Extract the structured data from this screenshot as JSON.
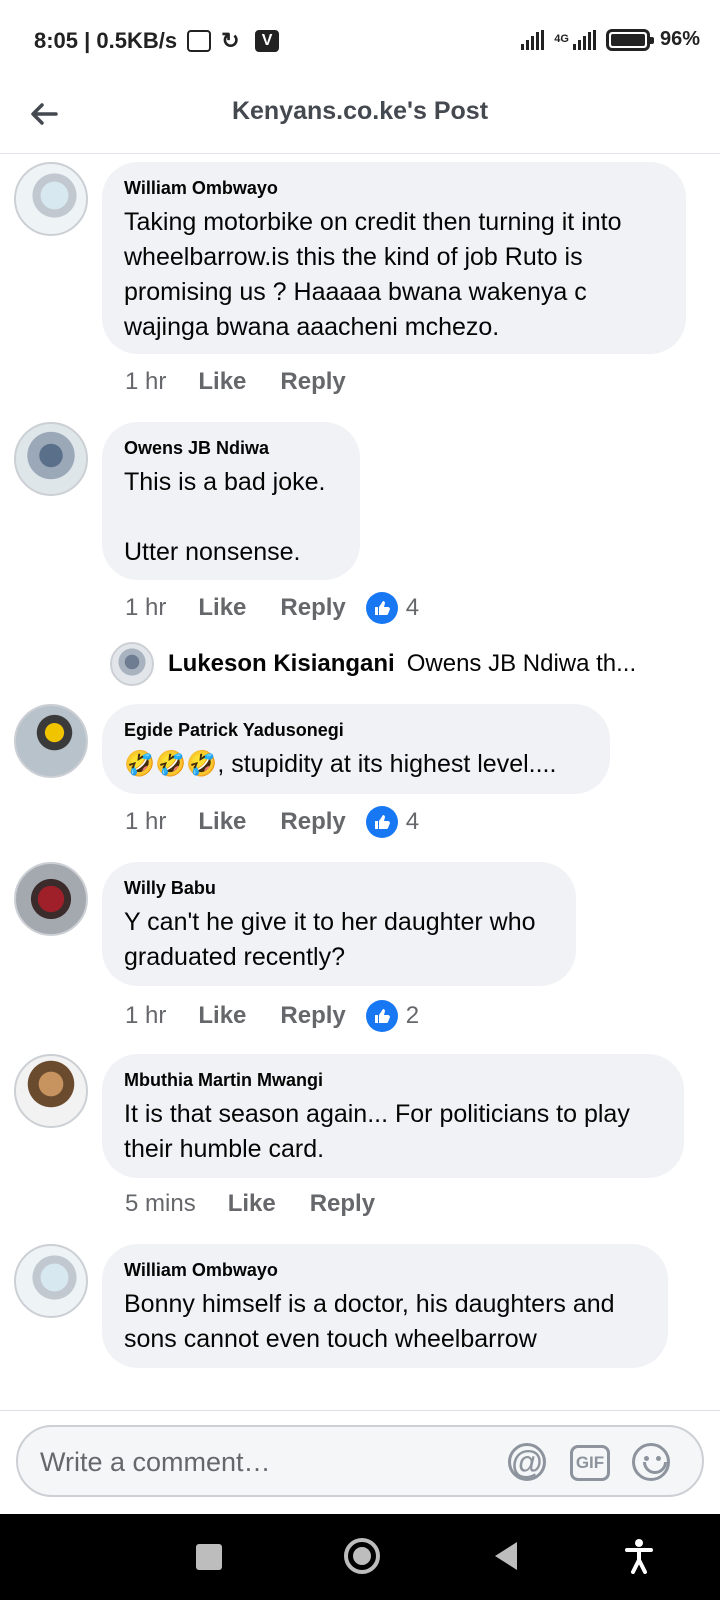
{
  "status_bar": {
    "time_speed": "8:05 | 0.5KB/s",
    "network": "4G",
    "battery": "96%",
    "icons": [
      "photo-icon",
      "swirl-icon",
      "v-app-icon",
      "signal-icon",
      "battery-icon"
    ]
  },
  "header": {
    "title": "Kenyans.co.ke's Post",
    "back_icon": "arrow-left-icon"
  },
  "comments": [
    {
      "author": "William Ombwayo",
      "text": " Taking motorbike on credit then turning it into\n wheelbarrow.is this the kind of job Ruto is\npromising us ? Haaaaa bwana wakenya c\nwajinga bwana aaacheni mchezo.",
      "time": "1 hr",
      "like": "Like",
      "reply": "Reply",
      "reactions": ""
    },
    {
      "author": "Owens JB Ndiwa",
      "text": "This is a bad joke.\n\nUtter nonsense.",
      "time": "1 hr",
      "like": "Like",
      "reply": "Reply",
      "reactions": "4"
    },
    {
      "author": "Egide Patrick Yadusonegi",
      "text": "🤣🤣🤣, stupidity at its highest level....",
      "time": "1 hr",
      "like": "Like",
      "reply": "Reply",
      "reactions": "4"
    },
    {
      "author": "Willy Babu",
      "text": "Y can't he give it to her daughter who\ngraduated recently?",
      "time": "1 hr",
      "like": "Like",
      "reply": "Reply",
      "reactions": "2"
    },
    {
      "author": "Mbuthia Martin Mwangi",
      "text": "It is that season again... For politicians to play\ntheir humble card.",
      "time": "5 mins",
      "like": "Like",
      "reply": "Reply",
      "reactions": ""
    },
    {
      "author": "William Ombwayo",
      "text": "Bonny himself is a doctor, his daughters and\nsons cannot even touch wheelbarrow",
      "time": "",
      "like": "",
      "reply": "",
      "reactions": ""
    }
  ],
  "reply_preview": {
    "author": "Lukeson Kisiangani",
    "text": "Owens JB Ndiwa  th..."
  },
  "composer": {
    "placeholder": "Write a comment…",
    "gif_label": "GIF",
    "at_label": "@"
  },
  "colors": {
    "bubble": "#f0f2f5",
    "like_blue": "#1877f2",
    "secondary_text": "#65676b"
  }
}
